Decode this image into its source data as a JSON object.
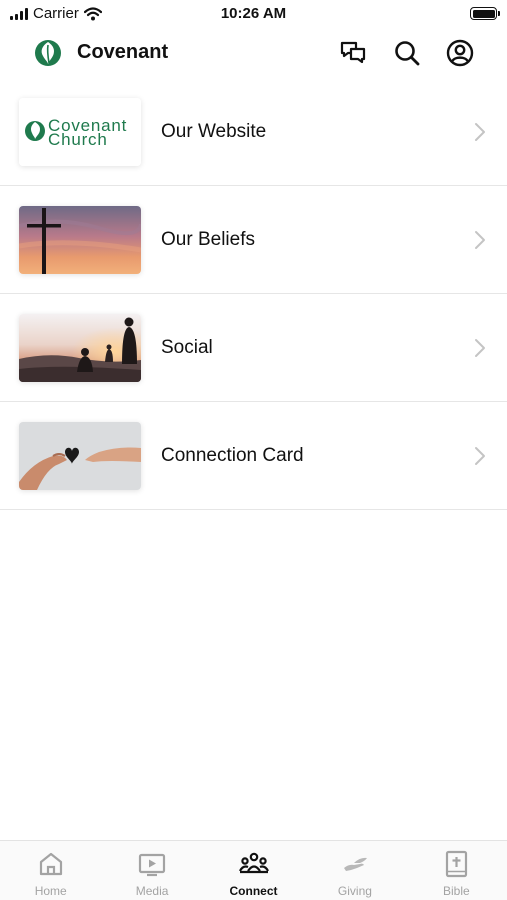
{
  "status_bar": {
    "carrier": "Carrier",
    "time": "10:26 AM"
  },
  "header": {
    "title": "Covenant",
    "brand_color": "#1f7a4d"
  },
  "items": [
    {
      "label": "Our Website",
      "thumb_text_line1": "Covenant",
      "thumb_text_line2": "Church"
    },
    {
      "label": "Our Beliefs"
    },
    {
      "label": "Social"
    },
    {
      "label": "Connection Card"
    }
  ],
  "tabs": [
    {
      "label": "Home",
      "icon": "home-icon",
      "active": false
    },
    {
      "label": "Media",
      "icon": "media-icon",
      "active": false
    },
    {
      "label": "Connect",
      "icon": "people-icon",
      "active": true
    },
    {
      "label": "Giving",
      "icon": "giving-hand-icon",
      "active": false
    },
    {
      "label": "Bible",
      "icon": "bible-icon",
      "active": false
    }
  ],
  "colors": {
    "active_tab": "#111111",
    "inactive_tab": "#a3a3a3",
    "divider": "#e6e6e6"
  }
}
